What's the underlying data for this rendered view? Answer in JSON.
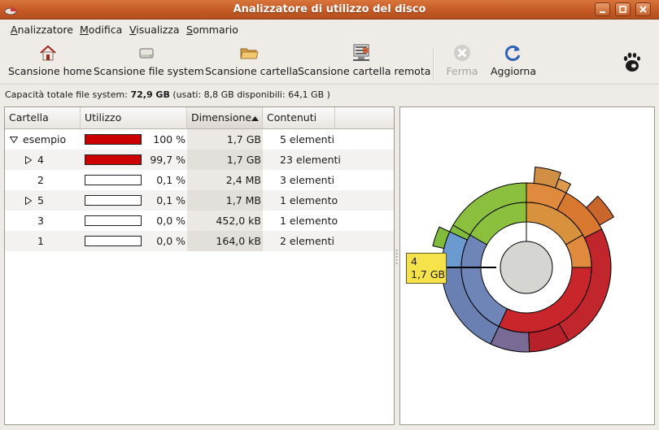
{
  "window": {
    "title": "Analizzatore di utilizzo del disco"
  },
  "menu": [
    {
      "label": "Analizzatore"
    },
    {
      "label": "Modifica"
    },
    {
      "label": "Visualizza"
    },
    {
      "label": "Sommario"
    }
  ],
  "toolbar": {
    "scan_home": "Scansione home",
    "scan_fs": "Scansione file system",
    "scan_folder": "Scansione cartella",
    "scan_remote": "Scansione cartella remota",
    "stop": "Ferma",
    "refresh": "Aggiorna"
  },
  "status": {
    "prefix": "Capacità totale file system:",
    "total": "72,9 GB",
    "detail": "(usati: 8,8 GB disponibili: 64,1 GB )"
  },
  "table": {
    "columns": [
      "Cartella",
      "Utilizzo",
      "Dimensione",
      "Contenuti"
    ],
    "rows": [
      {
        "name": "esempio",
        "percent": "100 %",
        "usage": 1.0,
        "size": "1,7 GB",
        "contents": "5 elementi",
        "expander": "expanded"
      },
      {
        "name": "4",
        "percent": "99,7 %",
        "usage": 0.997,
        "size": "1,7 GB",
        "contents": "23 elementi",
        "expander": "collapsed"
      },
      {
        "name": "2",
        "percent": "0,1 %",
        "usage": 0.001,
        "size": "2,4 MB",
        "contents": "3 elementi",
        "expander": "none"
      },
      {
        "name": "5",
        "percent": "0,1 %",
        "usage": 0.001,
        "size": "1,7 MB",
        "contents": "1 elemento",
        "expander": "collapsed"
      },
      {
        "name": "3",
        "percent": "0,0 %",
        "usage": 0.0,
        "size": "452,0 kB",
        "contents": "1 elemento",
        "expander": "none"
      },
      {
        "name": "1",
        "percent": "0,0 %",
        "usage": 0.0,
        "size": "164,0 kB",
        "contents": "2 elementi",
        "expander": "none"
      }
    ]
  },
  "ringchart_tooltip": {
    "name": "4",
    "size": "1,7 GB"
  },
  "colors": {
    "titlebar": "#c55a25",
    "usage_fill": "#cc0000",
    "tooltip_bg": "#f6e34c"
  }
}
